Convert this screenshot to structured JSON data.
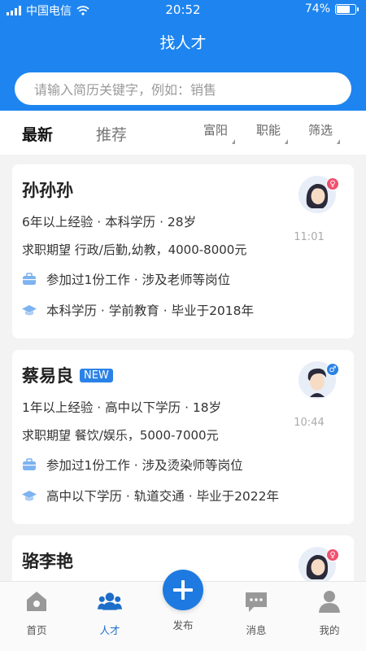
{
  "status_bar": {
    "carrier": "中国电信",
    "time": "20:52",
    "battery": "74%",
    "battery_level": 0.74
  },
  "header": {
    "title": "找人才"
  },
  "search": {
    "placeholder": "请输入简历关键字，例如：销售"
  },
  "filters": {
    "tabs": [
      {
        "label": "最新",
        "active": true
      },
      {
        "label": "推荐",
        "active": false
      }
    ],
    "dropdowns": [
      {
        "label": "富阳"
      },
      {
        "label": "职能"
      },
      {
        "label": "筛选"
      }
    ]
  },
  "candidates": [
    {
      "name": "孙孙孙",
      "is_new": false,
      "gender": "female",
      "meta": "6年以上经验 · 本科学历 · 28岁",
      "expect": "求职期望 行政/后勤,幼教，4000-8000元",
      "work": "参加过1份工作 · 涉及老师等岗位",
      "edu": "本科学历 · 学前教育 · 毕业于2018年",
      "time": "11:01"
    },
    {
      "name": "蔡易良",
      "is_new": true,
      "new_label": "NEW",
      "gender": "male",
      "meta": "1年以上经验 · 高中以下学历 · 18岁",
      "expect": "求职期望 餐饮/娱乐，5000-7000元",
      "work": "参加过1份工作 · 涉及烫染师等岗位",
      "edu": "高中以下学历 · 轨道交通 · 毕业于2022年",
      "time": "10:44"
    },
    {
      "name": "骆李艳",
      "is_new": false,
      "gender": "female"
    }
  ],
  "tabbar": {
    "items": [
      {
        "label": "首页",
        "icon": "home-icon"
      },
      {
        "label": "人才",
        "icon": "people-icon",
        "active": true
      },
      {
        "label": "发布",
        "icon": "plus-icon"
      },
      {
        "label": "消息",
        "icon": "message-icon"
      },
      {
        "label": "我的",
        "icon": "profile-icon"
      }
    ]
  },
  "colors": {
    "primary": "#1e85f0",
    "female": "#f0506e",
    "male": "#2b82e6"
  }
}
